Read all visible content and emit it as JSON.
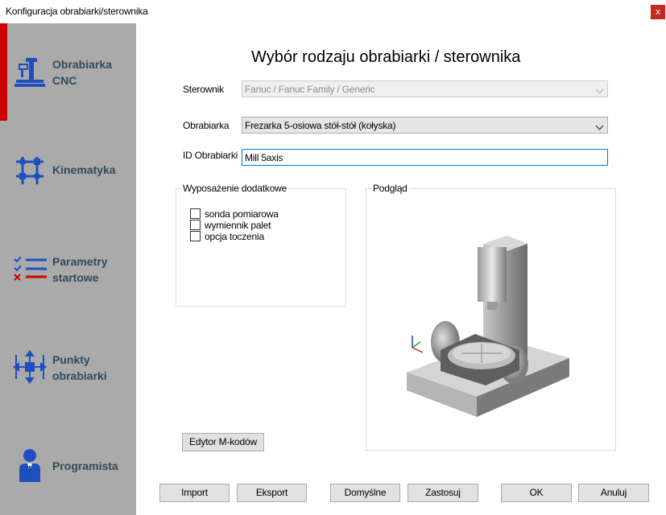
{
  "window": {
    "title": "Konfiguracja obrabiarki/sterownika",
    "close_glyph": "x"
  },
  "sidebar": {
    "items": [
      {
        "label": "Obrabiarka\nCNC",
        "icon": "cnc-machine-icon"
      },
      {
        "label": "Kinematyka",
        "icon": "kinematics-icon"
      },
      {
        "label": "Parametry\nstartowe",
        "icon": "checklist-icon"
      },
      {
        "label": "Punkty\nobrabiarki",
        "icon": "move-points-icon"
      },
      {
        "label": "Programista",
        "icon": "user-icon"
      }
    ]
  },
  "main": {
    "heading": "Wybór rodzaju obrabiarki / sterownika",
    "controller_label": "Sterownik",
    "controller_value": "Fanuc / Fanuc Family / Generic",
    "machine_label": "Obrabiarka",
    "machine_value": "Frezarka 5-osiowa stół-stół (kołyska)",
    "machine_id_label": "ID Obrabiarki",
    "machine_id_value": "Mill 5axis",
    "equipment": {
      "legend": "Wyposażenie dodatkowe",
      "options": [
        "sonda pomiarowa",
        "wymiennik palet",
        "opcja toczenia"
      ]
    },
    "preview_legend": "Podgląd",
    "mcode_editor_button": "Edytor M-kodów"
  },
  "footer": {
    "import": "Import",
    "export": "Eksport",
    "defaults": "Domyślne",
    "apply": "Zastosuj",
    "ok": "OK",
    "cancel": "Anuluj"
  },
  "colors": {
    "accent": "#cc0000",
    "sidebar_bg": "#aaaaaa",
    "icon_blue": "#1f4fbf",
    "label": "#2f4a5a"
  }
}
